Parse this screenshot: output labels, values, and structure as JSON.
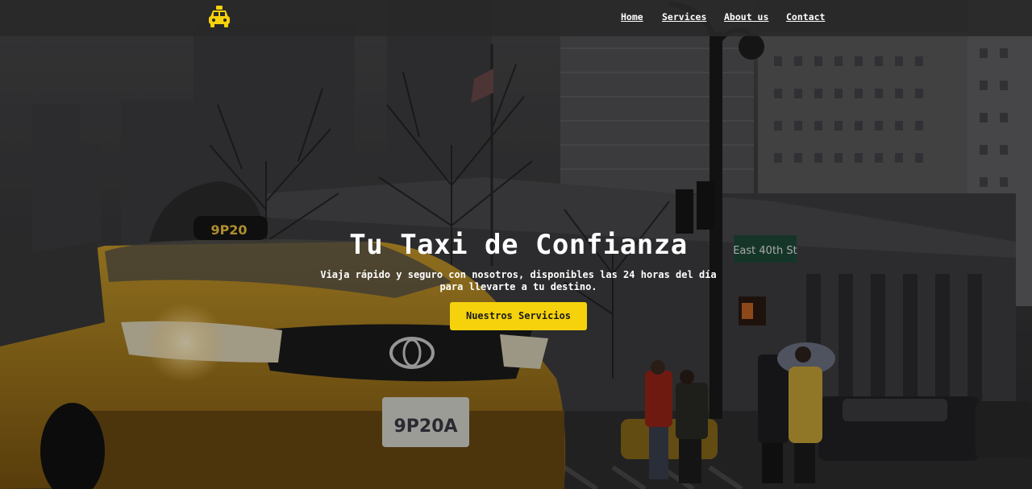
{
  "navbar": {
    "logo_icon": "taxi-icon",
    "links": [
      {
        "label": "Home"
      },
      {
        "label": "Services"
      },
      {
        "label": "About us"
      },
      {
        "label": "Contact"
      }
    ]
  },
  "hero": {
    "title": "Tu Taxi de Confianza",
    "subtitle": "Viaja rápido y seguro con nosotros, disponibles las 24 horas del día para llevarte a tu destino.",
    "cta_label": "Nuestros Servicios",
    "background": {
      "taxi_roof_sign": "9P20",
      "taxi_plate": "9P20A",
      "street_sign": "East 40th St"
    }
  },
  "colors": {
    "accent": "#f5d20c",
    "navbar_bg": "#282828",
    "text": "#ffffff"
  }
}
